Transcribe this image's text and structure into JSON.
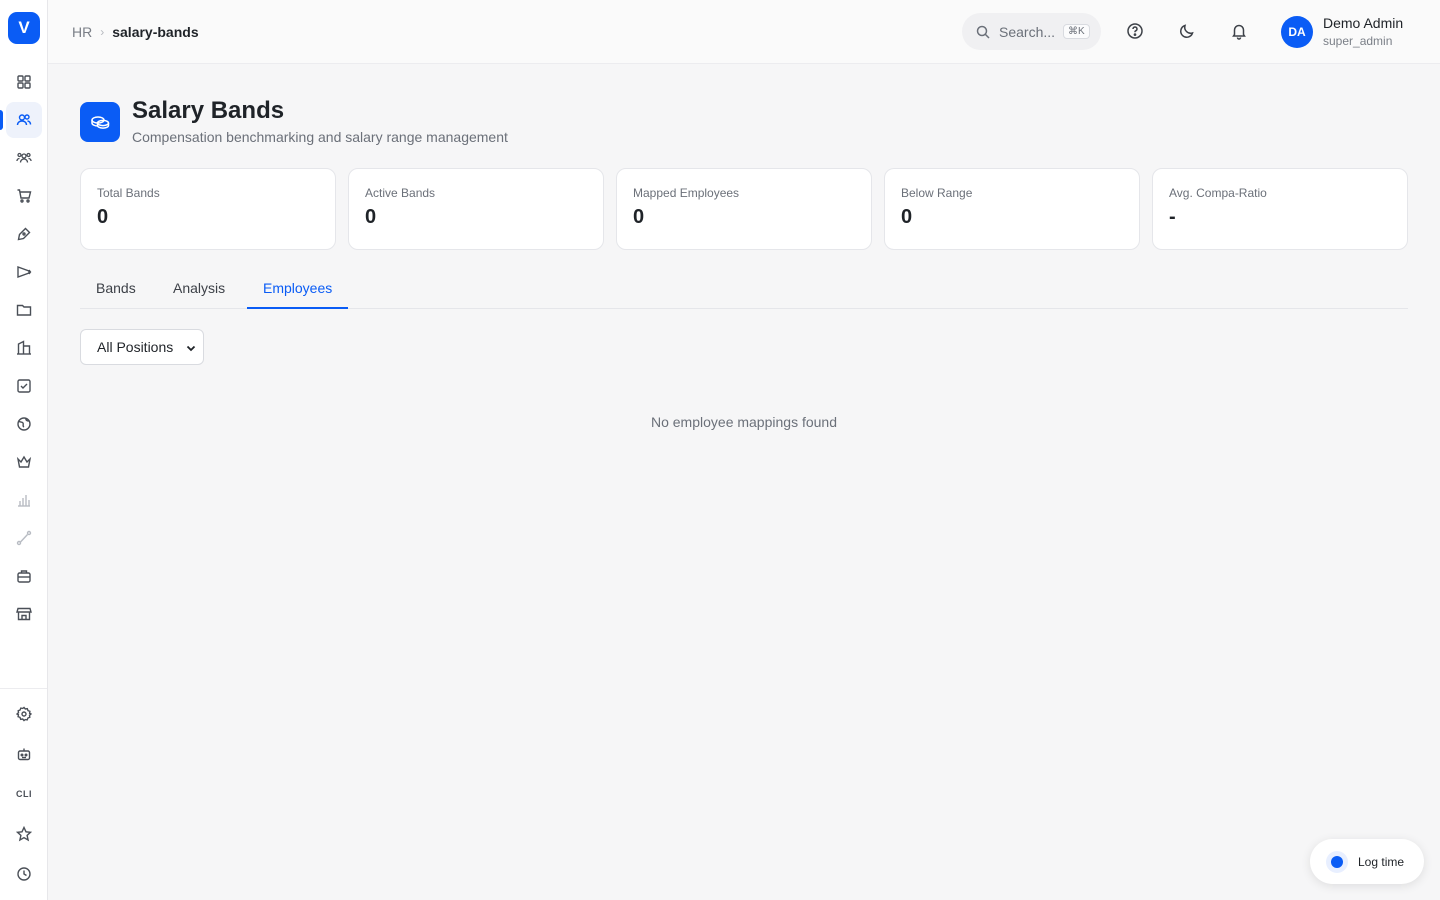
{
  "app": {
    "logo_letter": "V"
  },
  "breadcrumb": {
    "root": "HR",
    "separator": "›",
    "current": "salary-bands"
  },
  "search": {
    "placeholder": "Search...",
    "shortcut": "⌘K"
  },
  "user": {
    "initials": "DA",
    "name": "Demo Admin",
    "role": "super_admin"
  },
  "sidebar": {
    "items": [
      {
        "icon": "dashboard-grid-icon"
      },
      {
        "icon": "users-icon",
        "active": true
      },
      {
        "icon": "team-icon"
      },
      {
        "icon": "cart-icon"
      },
      {
        "icon": "pen-nib-icon"
      },
      {
        "icon": "megaphone-icon"
      },
      {
        "icon": "folder-icon"
      },
      {
        "icon": "building-icon"
      },
      {
        "icon": "checkbox-icon"
      },
      {
        "icon": "globe-icon"
      },
      {
        "icon": "crown-icon"
      },
      {
        "icon": "bar-chart-icon"
      },
      {
        "icon": "route-icon"
      },
      {
        "icon": "briefcase-icon"
      },
      {
        "icon": "store-icon"
      }
    ],
    "bottom": [
      {
        "icon": "settings-icon"
      },
      {
        "icon": "bot-icon"
      },
      {
        "label": "CLI"
      },
      {
        "icon": "star-icon"
      },
      {
        "icon": "clock-icon"
      }
    ]
  },
  "page": {
    "title": "Salary Bands",
    "subtitle": "Compensation benchmarking and salary range management",
    "icon": "coins-icon"
  },
  "stats": [
    {
      "label": "Total Bands",
      "value": "0"
    },
    {
      "label": "Active Bands",
      "value": "0"
    },
    {
      "label": "Mapped Employees",
      "value": "0"
    },
    {
      "label": "Below Range",
      "value": "0"
    },
    {
      "label": "Avg. Compa-Ratio",
      "value": "-"
    }
  ],
  "tabs": [
    {
      "label": "Bands"
    },
    {
      "label": "Analysis"
    },
    {
      "label": "Employees",
      "active": true
    }
  ],
  "filter": {
    "selected": "All Positions"
  },
  "empty_state": "No employee mappings found",
  "log_time": {
    "label": "Log time"
  },
  "colors": {
    "accent": "#0a5cf5",
    "background": "#f6f6f7"
  }
}
